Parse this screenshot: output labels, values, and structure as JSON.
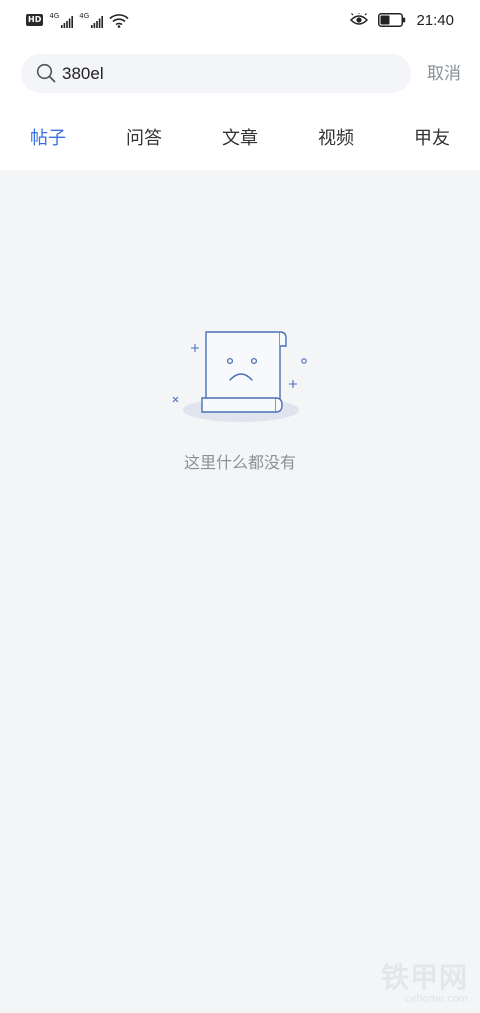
{
  "status_bar": {
    "hd_badge": "HD",
    "network_1": "4G",
    "network_2": "4G",
    "wifi_icon": "wifi-icon",
    "eye_icon": "eye-comfort-icon",
    "battery_level": 0.45,
    "time": "21:40"
  },
  "search": {
    "value": "380el",
    "icon": "search-icon",
    "cancel_label": "取消"
  },
  "tabs": [
    {
      "label": "帖子",
      "active": true
    },
    {
      "label": "问答",
      "active": false
    },
    {
      "label": "文章",
      "active": false
    },
    {
      "label": "视频",
      "active": false
    },
    {
      "label": "甲友",
      "active": false
    }
  ],
  "empty_state": {
    "illustration": "sad-document-icon",
    "message": "这里什么都没有"
  },
  "watermark": {
    "main": "铁甲网",
    "sub": "cehome.com"
  },
  "colors": {
    "accent": "#3a6fe0",
    "background": "#f4f5f7",
    "illustration": "#4a70b8"
  }
}
